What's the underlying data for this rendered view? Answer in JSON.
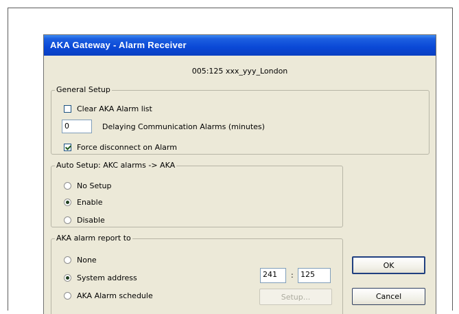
{
  "window": {
    "title": "AKA  Gateway - Alarm Receiver"
  },
  "header": {
    "text": "005:125  xxx_yyy_London"
  },
  "general_setup": {
    "title": "General Setup",
    "clear_alarm_list": {
      "label": "Clear AKA Alarm list",
      "checked": false
    },
    "delay": {
      "value": "0",
      "label": "Delaying Communication Alarms (minutes)"
    },
    "force_disconnect": {
      "label": "Force disconnect on Alarm",
      "checked": true
    }
  },
  "auto_setup": {
    "title": "Auto Setup: AKC alarms -> AKA",
    "options": [
      {
        "label": "No Setup",
        "selected": false
      },
      {
        "label": "Enable",
        "selected": true
      },
      {
        "label": "Disable",
        "selected": false
      }
    ]
  },
  "report": {
    "title": "AKA alarm report to",
    "options": [
      {
        "label": "None",
        "selected": false
      },
      {
        "label": "System address",
        "selected": true
      },
      {
        "label": "AKA Alarm schedule",
        "selected": false
      }
    ],
    "address_network": "241",
    "address_separator": ":",
    "address_node": "125",
    "setup_button": {
      "label": "Setup...",
      "enabled": false
    }
  },
  "buttons": {
    "ok": "OK",
    "cancel": "Cancel"
  },
  "colors": {
    "titlebar": "#0a48d6",
    "dialog_bg": "#ece9d8"
  }
}
